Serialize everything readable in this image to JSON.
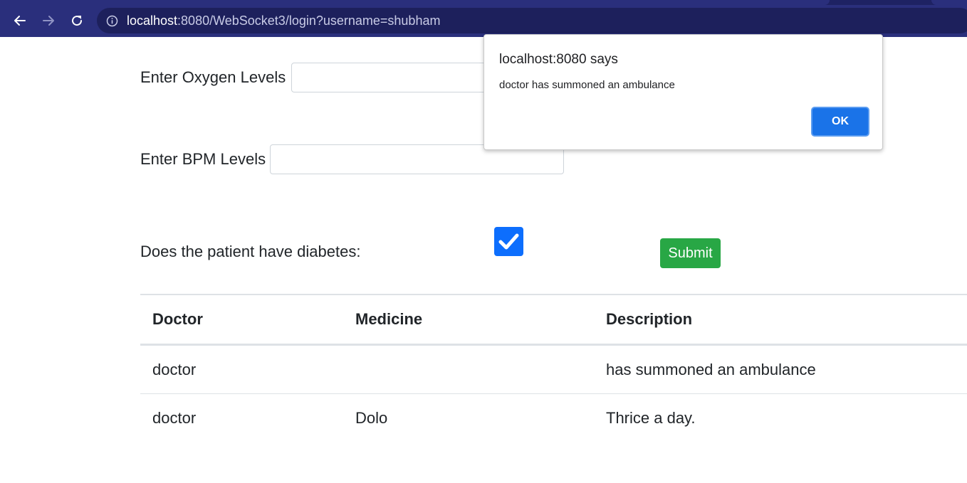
{
  "browser": {
    "url_host": "localhost",
    "url_rest": ":8080/WebSocket3/login?username=shubham",
    "icons": {
      "back": "arrow-left-icon",
      "forward": "arrow-right-icon",
      "reload": "reload-icon",
      "info": "info-icon"
    }
  },
  "form": {
    "oxygen_label": "Enter Oxygen Levels :",
    "oxygen_value": "",
    "bpm_label": "Enter BPM Levels :",
    "bpm_value": "",
    "diabetes_label": "Does the patient have diabetes:",
    "diabetes_checked": true,
    "submit_label": "Submit"
  },
  "table": {
    "headers": [
      "Doctor",
      "Medicine",
      "Description"
    ],
    "rows": [
      [
        "doctor",
        "",
        "has summoned an ambulance"
      ],
      [
        "doctor",
        "Dolo",
        "Thrice a day."
      ]
    ]
  },
  "dialog": {
    "title": "localhost:8080 says",
    "message": "doctor has summoned an ambulance",
    "ok_label": "OK"
  },
  "colors": {
    "browser_bar": "#2a2f7c",
    "submit_green": "#28a745",
    "checkbox_blue": "#0d6efd",
    "dialog_ok_blue": "#1a73e8"
  }
}
